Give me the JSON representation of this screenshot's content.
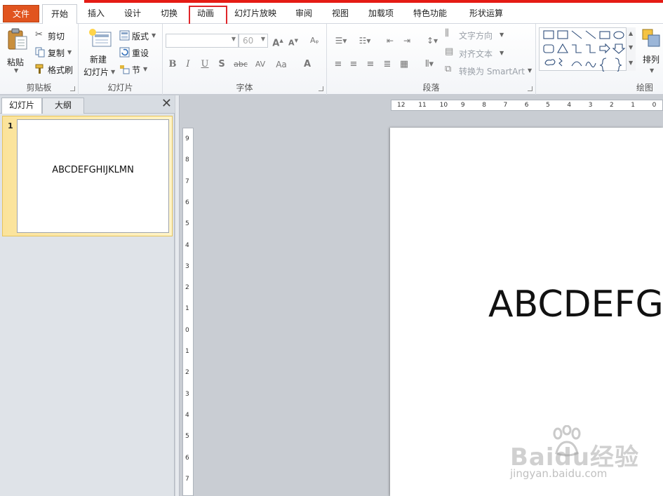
{
  "tabs": {
    "file": "文件",
    "home": "开始",
    "insert": "插入",
    "design": "设计",
    "transitions": "切换",
    "animations": "动画",
    "slideshow": "幻灯片放映",
    "review": "审阅",
    "view": "视图",
    "addins": "加载项",
    "special": "特色功能",
    "shape_ops": "形状运算"
  },
  "ribbon": {
    "clipboard": {
      "label": "剪贴板",
      "paste": "粘贴",
      "cut": "剪切",
      "copy": "复制",
      "format_painter": "格式刷"
    },
    "slides": {
      "label": "幻灯片",
      "new_slide_1": "新建",
      "new_slide_2": "幻灯片",
      "layout": "版式",
      "reset": "重设",
      "section": "节"
    },
    "font": {
      "label": "字体",
      "font_name": "",
      "font_size": "60"
    },
    "paragraph": {
      "label": "段落",
      "text_direction": "文字方向",
      "align_text": "对齐文本",
      "convert_smartart": "转换为 SmartArt"
    },
    "drawing": {
      "label": "绘图",
      "arrange": "排列"
    }
  },
  "left_pane": {
    "tab_slides": "幻灯片",
    "tab_outline": "大纲",
    "close": "✕",
    "slide_number": "1",
    "thumb_text": "ABCDEFGHIJKLMN"
  },
  "editor": {
    "slide_text": "ABCDEFGHIJKLMN",
    "hruler_labels": [
      "12",
      "11",
      "10",
      "9",
      "8",
      "7",
      "6",
      "5",
      "4",
      "3",
      "2",
      "1",
      "0"
    ],
    "vruler_labels": [
      "9",
      "8",
      "7",
      "6",
      "5",
      "4",
      "3",
      "2",
      "1",
      "0",
      "1",
      "2",
      "3",
      "4",
      "5",
      "6",
      "7"
    ]
  },
  "watermark": {
    "brand": "Baidu经验",
    "url": "jingyan.baidu.com"
  },
  "colors": {
    "file_tab": "#e1541f",
    "highlight": "#e0262a",
    "thumb_selected": "#fbe39a"
  }
}
